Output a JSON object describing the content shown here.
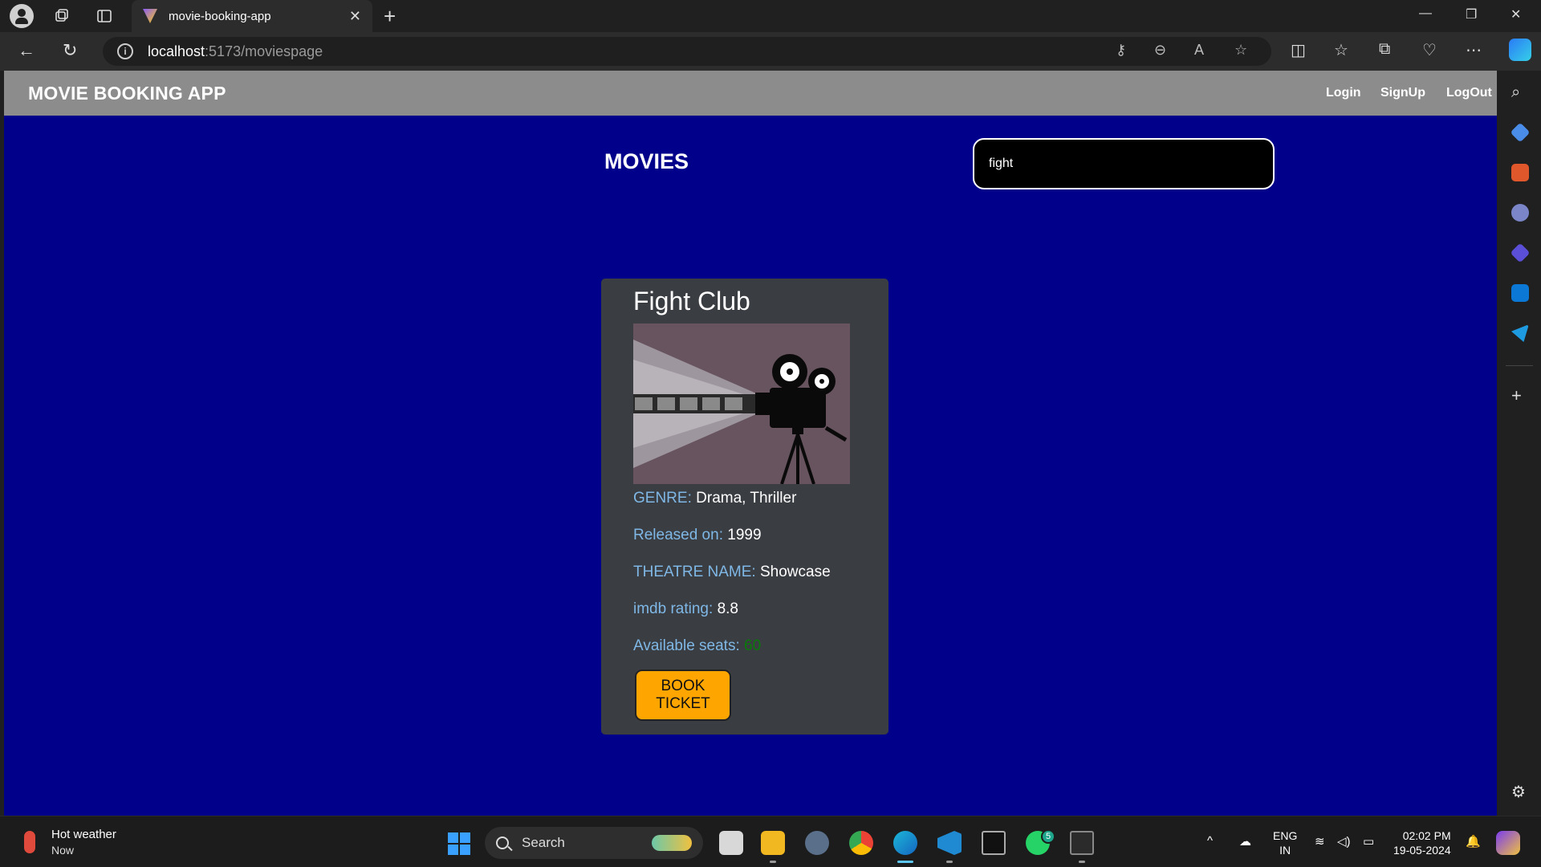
{
  "browser": {
    "tab_title": "movie-booking-app",
    "url_host": "localhost",
    "url_path": ":5173/moviespage"
  },
  "app": {
    "brand": "MOVIE BOOKING APP",
    "nav": {
      "login": "Login",
      "signup": "SignUp",
      "logout": "LogOut"
    },
    "page_title": "MOVIES",
    "search": {
      "value": "fight"
    }
  },
  "movie": {
    "title": "Fight Club",
    "genre_label": "GENRE:",
    "genre": "Drama, Thriller",
    "released_label": "Released on:",
    "released": "1999",
    "theatre_label": "THEATRE NAME:",
    "theatre": "Showcase",
    "rating_label": "imdb rating:",
    "rating": "8.8",
    "seats_label": "Available seats:",
    "seats": "60",
    "book_label": "BOOK TICKET"
  },
  "taskbar": {
    "weather_title": "Hot weather",
    "weather_sub": "Now",
    "search_label": "Search",
    "whatsapp_badge": "5",
    "lang_1": "ENG",
    "lang_2": "IN",
    "time": "02:02 PM",
    "date": "19-05-2024"
  },
  "colors": {
    "page_bg": "#00008b",
    "appbar_bg": "#8c8c8c",
    "card_bg": "#3a3d42",
    "label_color": "#7fb8e6",
    "button_bg": "#ffa500",
    "seats_color": "#0a7a0a"
  }
}
